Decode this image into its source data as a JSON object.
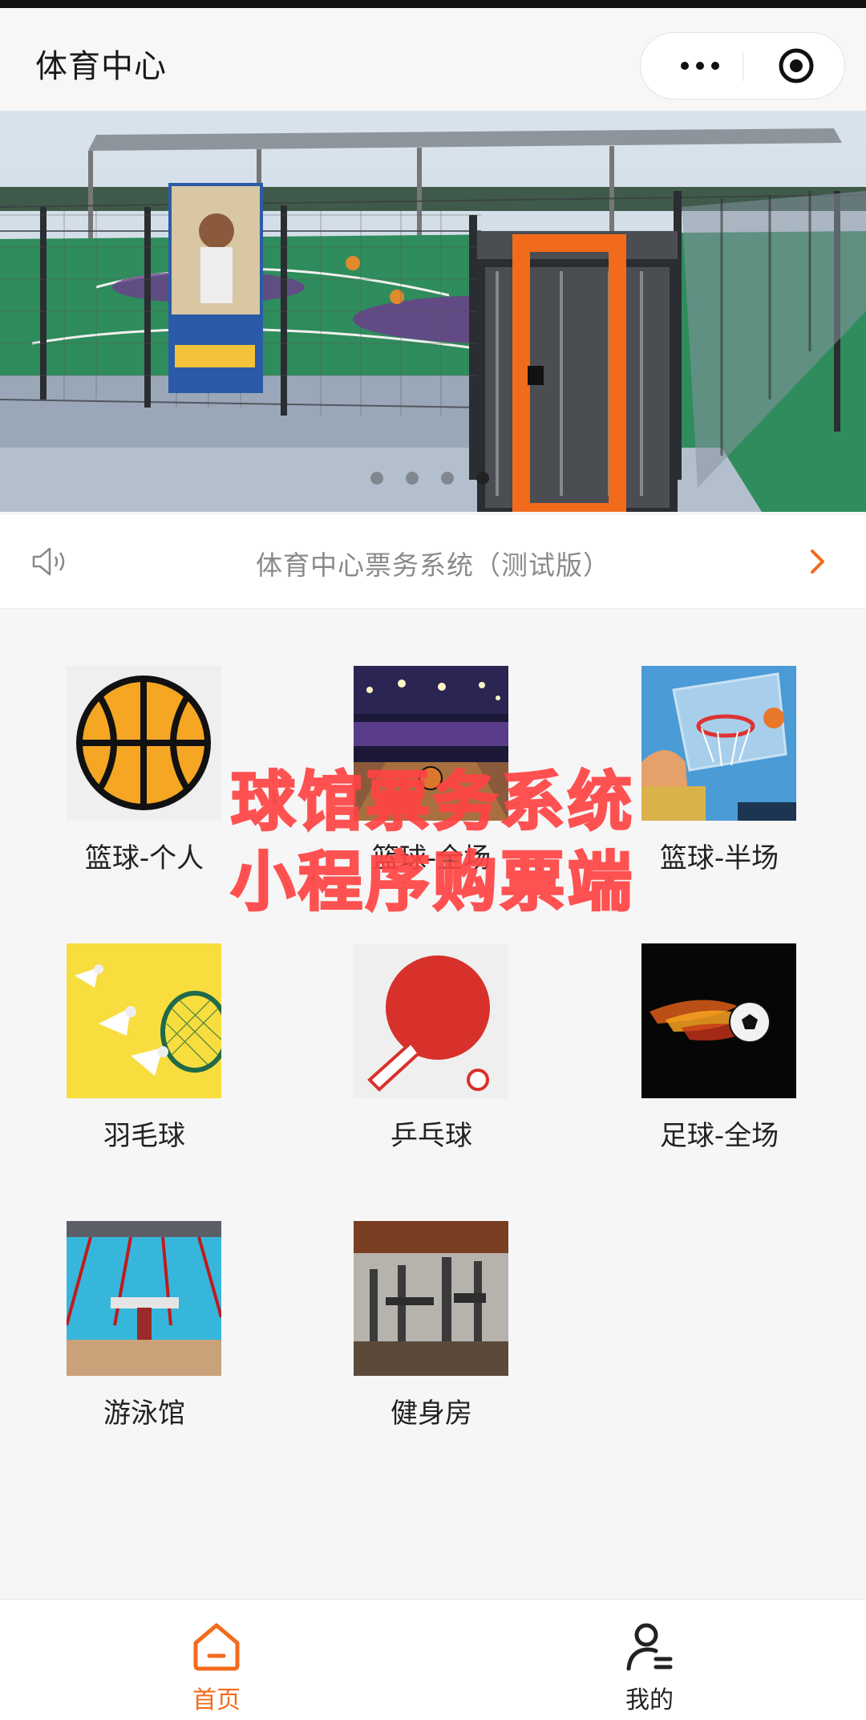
{
  "header": {
    "title": "体育中心"
  },
  "notice": {
    "text": "体育中心票务系统（测试版）"
  },
  "banner": {
    "slides": 4,
    "active": 4
  },
  "categories": [
    {
      "label": "篮球-个人",
      "icon": "basketball-icon"
    },
    {
      "label": "篮球-全场",
      "icon": "arena-photo"
    },
    {
      "label": "篮球-半场",
      "icon": "basketball-hoop-photo"
    },
    {
      "label": "羽毛球",
      "icon": "badminton-photo"
    },
    {
      "label": "乒乓球",
      "icon": "ping-pong-icon"
    },
    {
      "label": "足球-全场",
      "icon": "fire-football-photo"
    },
    {
      "label": "游泳馆",
      "icon": "swimming-pool-photo"
    },
    {
      "label": "健身房",
      "icon": "gym-photo"
    }
  ],
  "watermark": {
    "line1": "球馆票务系统",
    "line2": "小程序购票端"
  },
  "tabbar": {
    "home": "首页",
    "mine": "我的"
  },
  "colors": {
    "accent": "#f26b1d",
    "watermark": "#f23b3b"
  }
}
